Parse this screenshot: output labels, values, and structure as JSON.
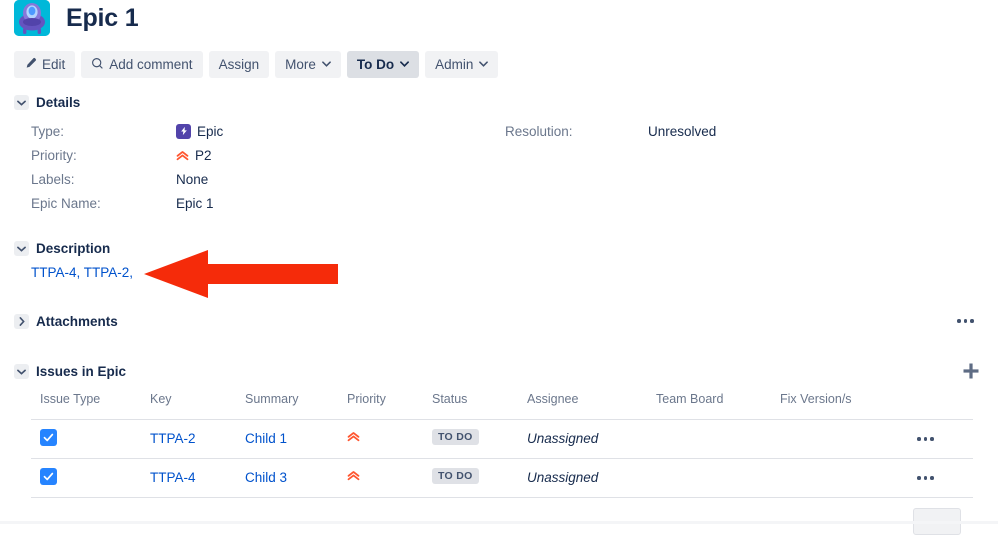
{
  "header": {
    "title": "Epic 1",
    "avatar_icon": "epic-alien-avatar"
  },
  "toolbar": {
    "edit_label": "Edit",
    "edit_icon": "pencil-icon",
    "add_comment_label": "Add comment",
    "add_comment_icon": "search-icon",
    "assign_label": "Assign",
    "more_label": "More",
    "more_caret_icon": "chevron-down-icon",
    "status_label": "To Do",
    "status_caret_icon": "chevron-down-icon",
    "admin_label": "Admin",
    "admin_caret_icon": "chevron-down-icon"
  },
  "details": {
    "section_title": "Details",
    "twisty_icon": "chevron-down-icon",
    "fields": [
      {
        "label": "Type:",
        "value": "Epic",
        "icon": "epic-lightning-icon"
      },
      {
        "label": "Priority:",
        "value": "P2",
        "icon": "priority-high-double-chevron-icon"
      },
      {
        "label": "Labels:",
        "value": "None",
        "icon": ""
      },
      {
        "label": "Epic Name:",
        "value": "Epic 1",
        "icon": ""
      }
    ],
    "right_fields": [
      {
        "label": "Resolution:",
        "value": "Unresolved"
      }
    ]
  },
  "description": {
    "section_title": "Description",
    "twisty_icon": "chevron-down-icon",
    "body_text": "TTPA-4, TTPA-2,"
  },
  "annotation": {
    "arrow_icon": "left-arrow-annotation",
    "arrow_color": "#f52b0a"
  },
  "attachments": {
    "section_title": "Attachments",
    "twisty_icon": "chevron-right-icon",
    "more_menu_icon": "ellipsis-icon"
  },
  "issues_in_epic": {
    "section_title": "Issues in Epic",
    "twisty_icon": "chevron-down-icon",
    "add_icon": "plus-icon",
    "columns": [
      "Issue Type",
      "Key",
      "Summary",
      "Priority",
      "Status",
      "Assignee",
      "Team Board",
      "Fix Version/s"
    ],
    "rows": [
      {
        "checked": "checkbox-checked-icon",
        "key": "TTPA-2",
        "summary": "Child 1",
        "priority_icon": "priority-high-double-chevron-icon",
        "status": "TO DO",
        "assignee": "Unassigned",
        "team_board": "",
        "fix_versions": "",
        "more_menu_icon": "ellipsis-icon"
      },
      {
        "checked": "checkbox-checked-icon",
        "key": "TTPA-4",
        "summary": "Child 3",
        "priority_icon": "priority-high-double-chevron-icon",
        "status": "TO DO",
        "assignee": "Unassigned",
        "team_board": "",
        "fix_versions": "",
        "more_menu_icon": "ellipsis-icon"
      }
    ]
  },
  "colors": {
    "link": "#0052cc",
    "text": "#172b4d",
    "muted": "#6b778c",
    "button_bg": "#f1f2f4",
    "button_active_bg": "#dcdfe4",
    "checkbox": "#2684ff",
    "epic_purple": "#5243aa",
    "avatar_teal": "#00b8d9",
    "priority_orange": "#ff5630",
    "badge_bg": "#dfe1e6",
    "annotation_red": "#f52b0a"
  }
}
